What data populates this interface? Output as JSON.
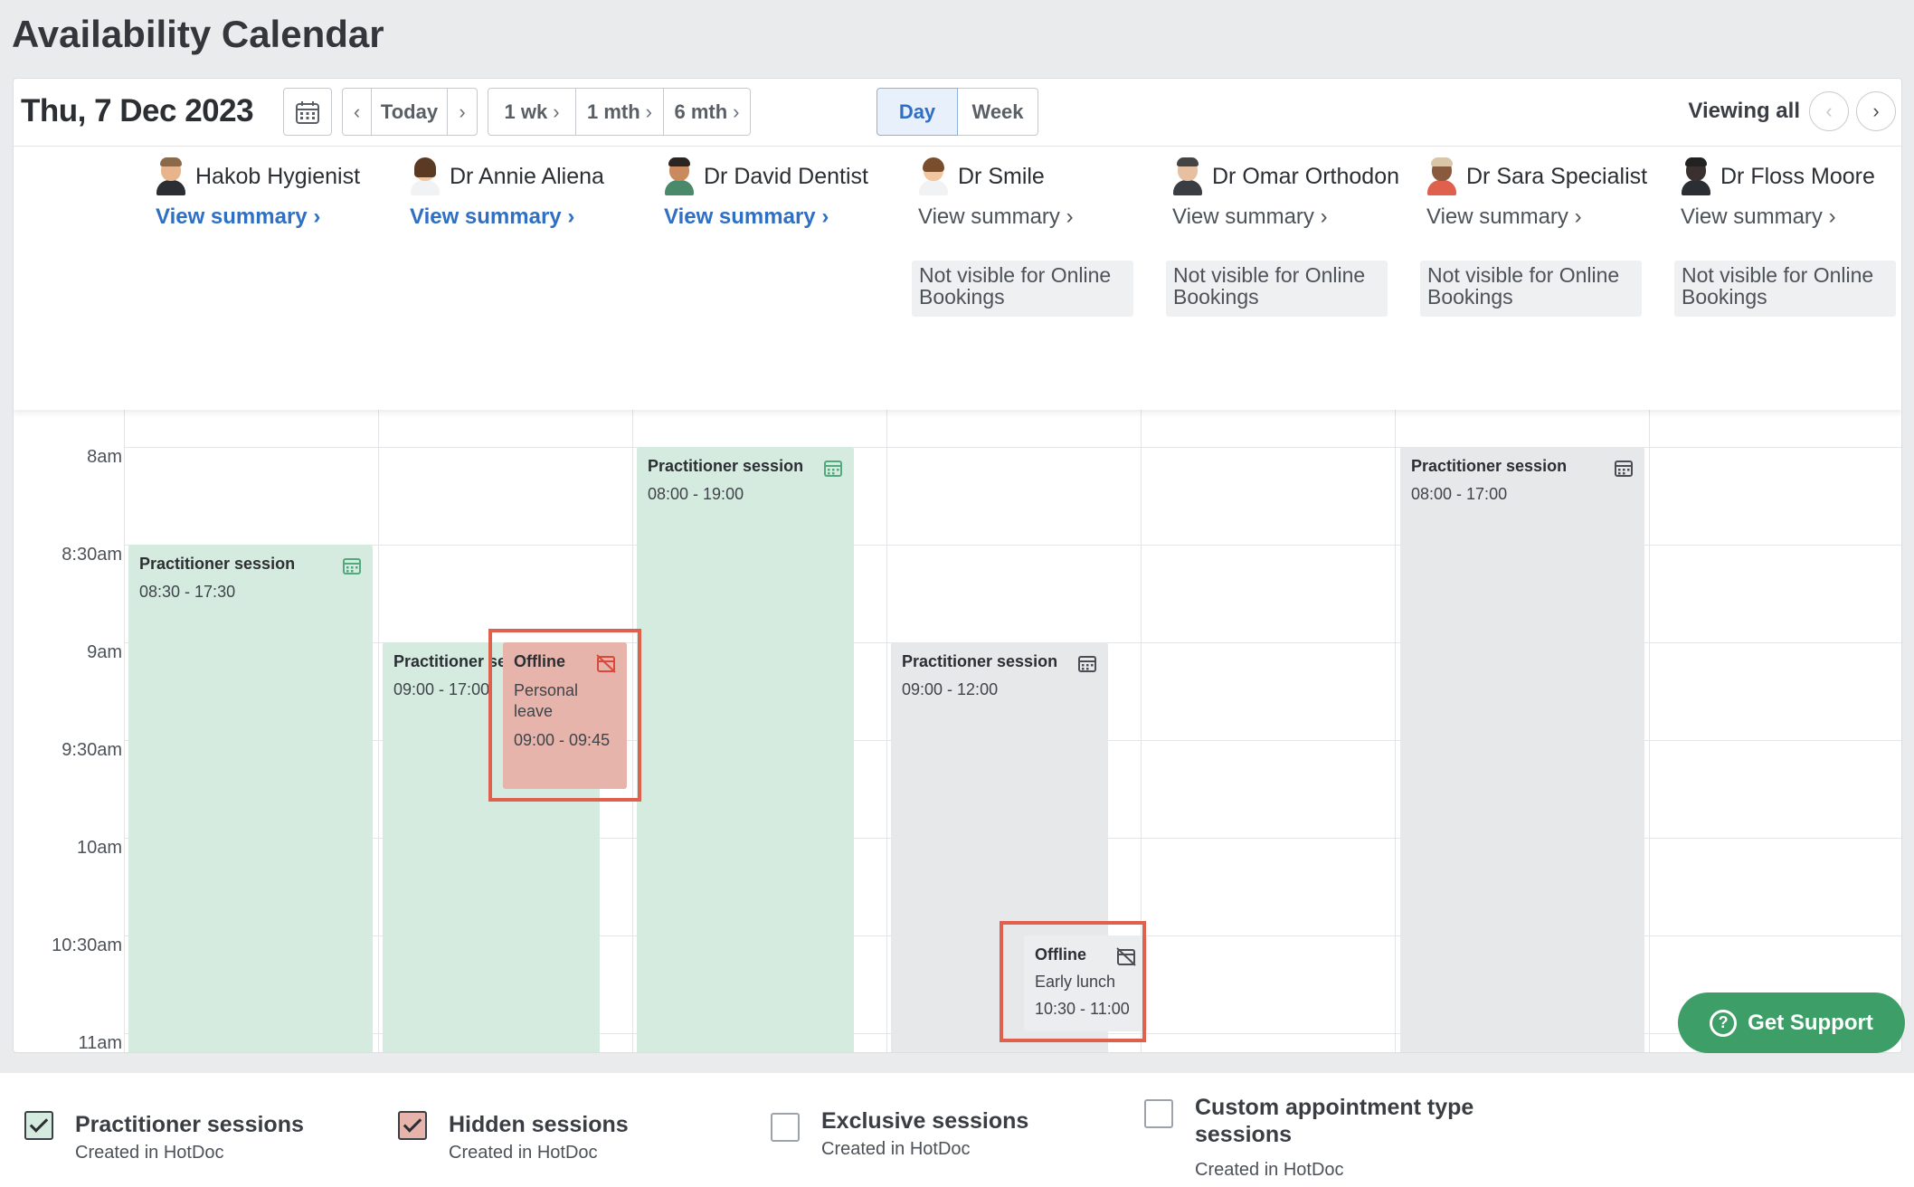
{
  "page": {
    "title": "Availability Calendar"
  },
  "toolbar": {
    "date": "Thu, 7 Dec 2023",
    "prev_icon": "chevron-left-icon",
    "today_label": "Today",
    "next_icon": "chevron-right-icon",
    "range_buttons": [
      "1 wk",
      "1 mth",
      "6 mth"
    ],
    "view_modes": [
      "Day",
      "Week"
    ],
    "active_view": "Day",
    "viewing_label": "Viewing all"
  },
  "practitioners": [
    {
      "name": "Hakob Hygienist",
      "summary": "View summary",
      "online": true,
      "hair": "#8a6a4a",
      "skin": "#e8b48c"
    },
    {
      "name": "Dr Annie Aliena",
      "summary": "View summary",
      "online": true,
      "hair": "#5a3a22",
      "skin": "#f2c6a0"
    },
    {
      "name": "Dr David Dentist",
      "summary": "View summary",
      "online": true,
      "hair": "#2b2420",
      "skin": "#c98a5e"
    },
    {
      "name": "Dr Smile",
      "summary": "View summary",
      "online": false,
      "note": "Not visible for Online Bookings",
      "hair": "#7a4e2c",
      "skin": "#f2c6a0"
    },
    {
      "name": "Dr Omar Orthodon",
      "summary": "View summary",
      "online": false,
      "note": "Not visible for Online Bookings",
      "hair": "#444",
      "skin": "#e6c0a0"
    },
    {
      "name": "Dr Sara Specialist",
      "summary": "View summary",
      "online": false,
      "note": "Not visible for Online Bookings",
      "hair": "#d9c5a8",
      "skin": "#8a5a3e"
    },
    {
      "name": "Dr Floss Moore",
      "summary": "View summary",
      "online": false,
      "note": "Not visible for Online Bookings",
      "hair": "#222",
      "skin": "#3a3030"
    }
  ],
  "time_labels": [
    "8am",
    "8:30am",
    "9am",
    "9:30am",
    "10am",
    "10:30am",
    "11am"
  ],
  "events": {
    "hakob_session": {
      "title": "Practitioner session",
      "time": "08:30 - 17:30"
    },
    "annie_session": {
      "title": "Practitioner session",
      "time": "09:00 - 17:00"
    },
    "annie_offline": {
      "title": "Offline",
      "reason": "Personal leave",
      "time": "09:00 - 09:45"
    },
    "david_session": {
      "title": "Practitioner session",
      "time": "08:00 - 19:00"
    },
    "smile_session": {
      "title": "Practitioner session",
      "time": "09:00 - 12:00"
    },
    "smile_offline": {
      "title": "Offline",
      "reason": "Early lunch",
      "time": "10:30 - 11:00"
    },
    "sara_session": {
      "title": "Practitioner session",
      "time": "08:00 - 17:00"
    }
  },
  "support": {
    "label": "Get Support"
  },
  "legend": [
    {
      "title": "Practitioner sessions",
      "sub": "Created in HotDoc",
      "checked": true
    },
    {
      "title": "Hidden sessions",
      "sub": "Created in HotDoc",
      "checked": true
    },
    {
      "title": "Exclusive sessions",
      "sub": "Created in HotDoc",
      "checked": false
    },
    {
      "title": "Custom appointment type sessions",
      "sub": "Created in HotDoc",
      "checked": false
    }
  ],
  "colors": {
    "session_green": "#d5ebe0",
    "session_gray": "#e7e8ea",
    "offline_red": "#e6b4ab",
    "highlight": "#e0604e",
    "accent_blue": "#2f6fc4",
    "support_green": "#3e9e68"
  }
}
